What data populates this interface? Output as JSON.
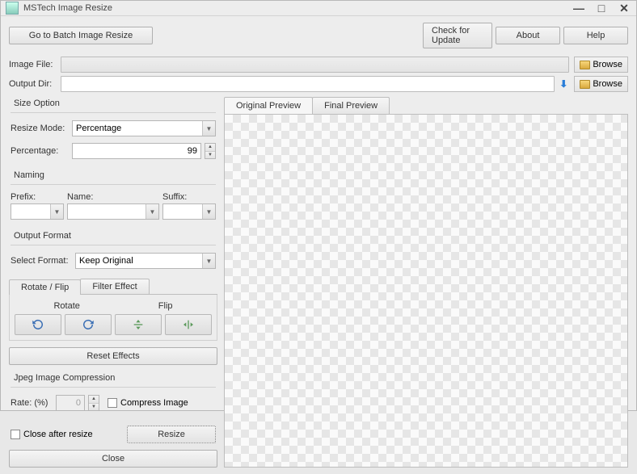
{
  "title": "MSTech Image Resize",
  "toolbar": {
    "batch": "Go to Batch Image Resize",
    "update": "Check for Update",
    "about": "About",
    "help": "Help"
  },
  "file": {
    "image_label": "Image File:",
    "output_label": "Output Dir:",
    "browse": "Browse"
  },
  "size": {
    "group": "Size Option",
    "mode_label": "Resize Mode:",
    "mode_value": "Percentage",
    "pct_label": "Percentage:",
    "pct_value": "99"
  },
  "naming": {
    "group": "Naming",
    "prefix": "Prefix:",
    "name": "Name:",
    "suffix": "Suffix:"
  },
  "format": {
    "group": "Output Format",
    "label": "Select Format:",
    "value": "Keep Original"
  },
  "rf": {
    "tab1": "Rotate / Flip",
    "tab2": "Filter Effect",
    "rotate": "Rotate",
    "flip": "Flip",
    "reset": "Reset Effects"
  },
  "jpeg": {
    "group": "Jpeg Image Compression",
    "rate_label": "Rate: (%)",
    "rate_value": "0",
    "compress": "Compress Image"
  },
  "actions": {
    "close_after": "Close after resize",
    "resize": "Resize",
    "close": "Close"
  },
  "preview": {
    "original": "Original Preview",
    "final": "Final Preview"
  }
}
